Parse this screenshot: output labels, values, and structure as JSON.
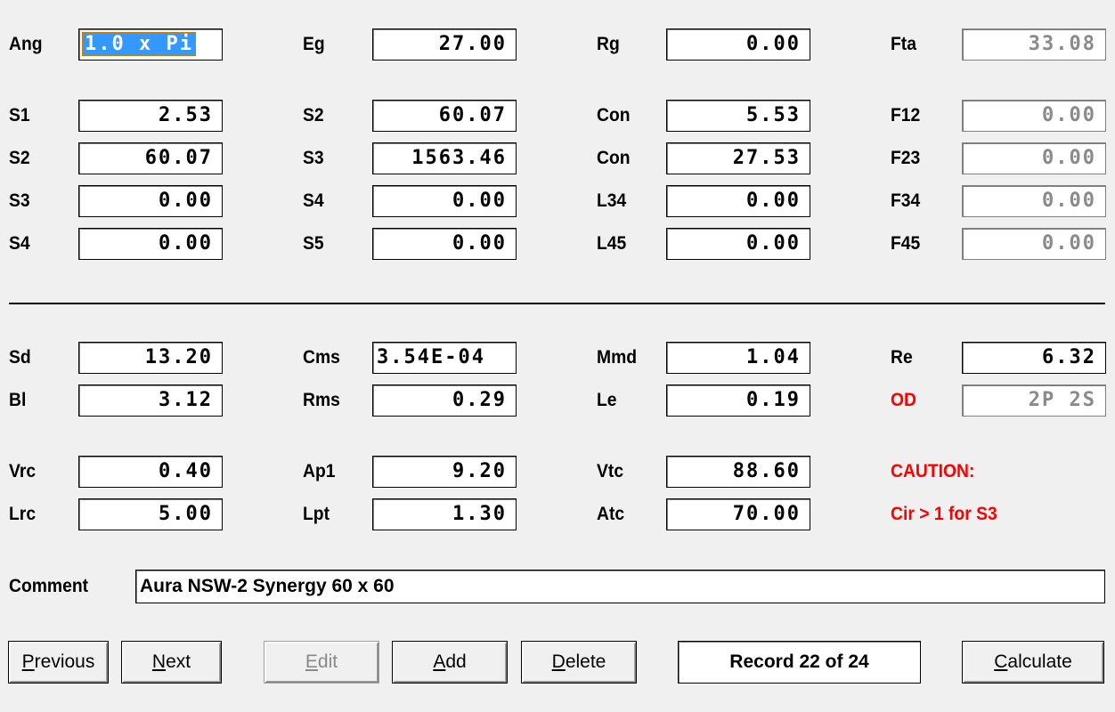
{
  "row_top": [
    {
      "label": "Ang",
      "value": "1.0 x Pi"
    },
    {
      "label": "Eg",
      "value": "27.00"
    },
    {
      "label": "Rg",
      "value": "0.00"
    },
    {
      "label": "Fta",
      "value": "33.08"
    }
  ],
  "grid1": [
    [
      {
        "label": "S1",
        "value": "2.53"
      },
      {
        "label": "S2",
        "value": "60.07"
      },
      {
        "label": "Con",
        "value": "5.53"
      },
      {
        "label": "F12",
        "value": "0.00"
      }
    ],
    [
      {
        "label": "S2",
        "value": "60.07"
      },
      {
        "label": "S3",
        "value": "1563.46"
      },
      {
        "label": "Con",
        "value": "27.53"
      },
      {
        "label": "F23",
        "value": "0.00"
      }
    ],
    [
      {
        "label": "S3",
        "value": "0.00"
      },
      {
        "label": "S4",
        "value": "0.00"
      },
      {
        "label": "L34",
        "value": "0.00"
      },
      {
        "label": "F34",
        "value": "0.00"
      }
    ],
    [
      {
        "label": "S4",
        "value": "0.00"
      },
      {
        "label": "S5",
        "value": "0.00"
      },
      {
        "label": "L45",
        "value": "0.00"
      },
      {
        "label": "F45",
        "value": "0.00"
      }
    ]
  ],
  "grid2": [
    [
      {
        "label": "Sd",
        "value": "13.20"
      },
      {
        "label": "Cms",
        "value": "3.54E-04"
      },
      {
        "label": "Mmd",
        "value": "1.04"
      },
      {
        "label": "Re",
        "value": "6.32"
      }
    ],
    [
      {
        "label": "Bl",
        "value": "3.12"
      },
      {
        "label": "Rms",
        "value": "0.29"
      },
      {
        "label": "Le",
        "value": "0.19"
      },
      {
        "label": "OD",
        "value": "2P 2S"
      }
    ]
  ],
  "grid3": [
    [
      {
        "label": "Vrc",
        "value": "0.40"
      },
      {
        "label": "Ap1",
        "value": "9.20"
      },
      {
        "label": "Vtc",
        "value": "88.60"
      }
    ],
    [
      {
        "label": "Lrc",
        "value": "5.00"
      },
      {
        "label": "Lpt",
        "value": "1.30"
      },
      {
        "label": "Atc",
        "value": "70.00"
      }
    ]
  ],
  "caution": {
    "title": "CAUTION:",
    "message": "Cir > 1 for S3"
  },
  "comment": {
    "label": "Comment",
    "value": "Aura NSW-2 Synergy 60 x 60"
  },
  "buttons": {
    "previous": {
      "hot": "P",
      "rest": "revious"
    },
    "next": {
      "hot": "N",
      "rest": "ext"
    },
    "edit": {
      "hot": "E",
      "rest": "dit"
    },
    "add": {
      "hot": "A",
      "rest": "dd"
    },
    "delete": {
      "hot": "D",
      "rest": "elete"
    },
    "calculate": {
      "hot": "C",
      "rest": "alculate"
    }
  },
  "record": "Record 22 of 24",
  "colors": {
    "background": "#f0f0f0",
    "caution": "#ff0000",
    "selection": "#3399ff",
    "disabled": "#8a8a8a"
  }
}
